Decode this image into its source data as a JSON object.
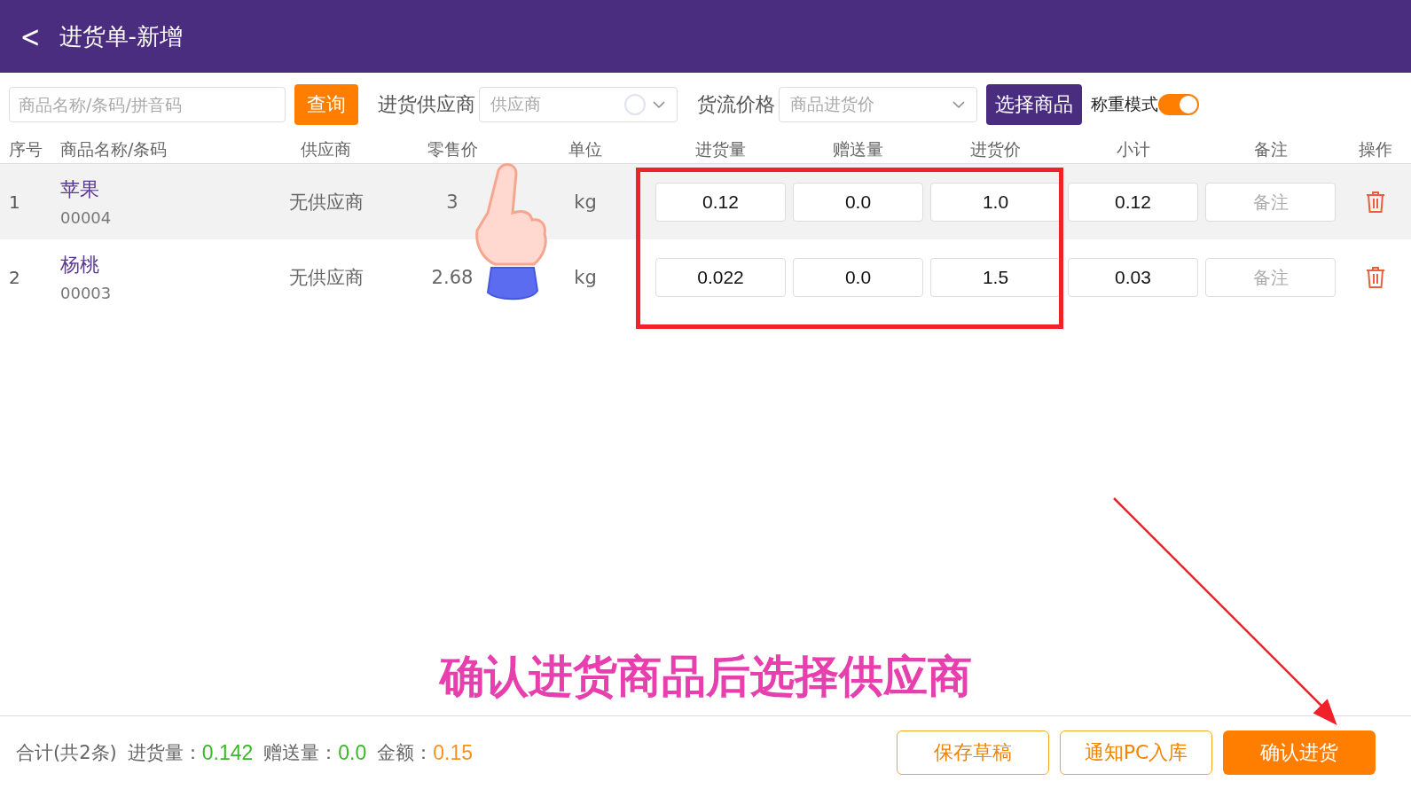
{
  "header": {
    "back": "<",
    "title": "进货单-新增"
  },
  "toolbar": {
    "search": {
      "placeholder": "商品名称/条码/拼音码"
    },
    "query_button": "查询",
    "supplier_label": "进货供应商",
    "supplier_select": {
      "placeholder": "供应商"
    },
    "price_label": "货流价格",
    "price_select": {
      "value": "商品进货价"
    },
    "choose_button": "选择商品",
    "weigh_mode": {
      "label": "称重模式",
      "on": true
    }
  },
  "table": {
    "columns": [
      "序号",
      "商品名称/条码",
      "供应商",
      "零售价",
      "单位",
      "进货量",
      "赠送量",
      "进货价",
      "小计",
      "备注",
      "操作"
    ],
    "rows": [
      {
        "index": "1",
        "name": "苹果",
        "code": "00004",
        "supplier": "无供应商",
        "retail": "3",
        "unit": "kg",
        "qty": "0.12",
        "gift": "0.0",
        "price": "1.0",
        "subtotal": "0.12",
        "remark": {
          "placeholder": "备注"
        },
        "selected": true
      },
      {
        "index": "2",
        "name": "杨桃",
        "code": "00003",
        "supplier": "无供应商",
        "retail": "2.68",
        "unit": "kg",
        "qty": "0.022",
        "gift": "0.0",
        "price": "1.5",
        "subtotal": "0.03",
        "remark": {
          "placeholder": "备注"
        },
        "selected": false
      }
    ]
  },
  "caption": "确认进货商品后选择供应商",
  "footer": {
    "summary": "合计(共2条)",
    "stats": [
      {
        "label": "进货量：",
        "value": "0.142",
        "color": "#3bb82a"
      },
      {
        "label": "赠送量：",
        "value": "0.0",
        "color": "#3bb82a"
      },
      {
        "label": "金额：",
        "value": "0.15",
        "color": "#f5921e"
      }
    ],
    "buttons": [
      {
        "label": "保存草稿",
        "kind": "outline"
      },
      {
        "label": "通知PC入库",
        "kind": "outline"
      },
      {
        "label": "确认进货",
        "kind": "primary"
      }
    ]
  }
}
